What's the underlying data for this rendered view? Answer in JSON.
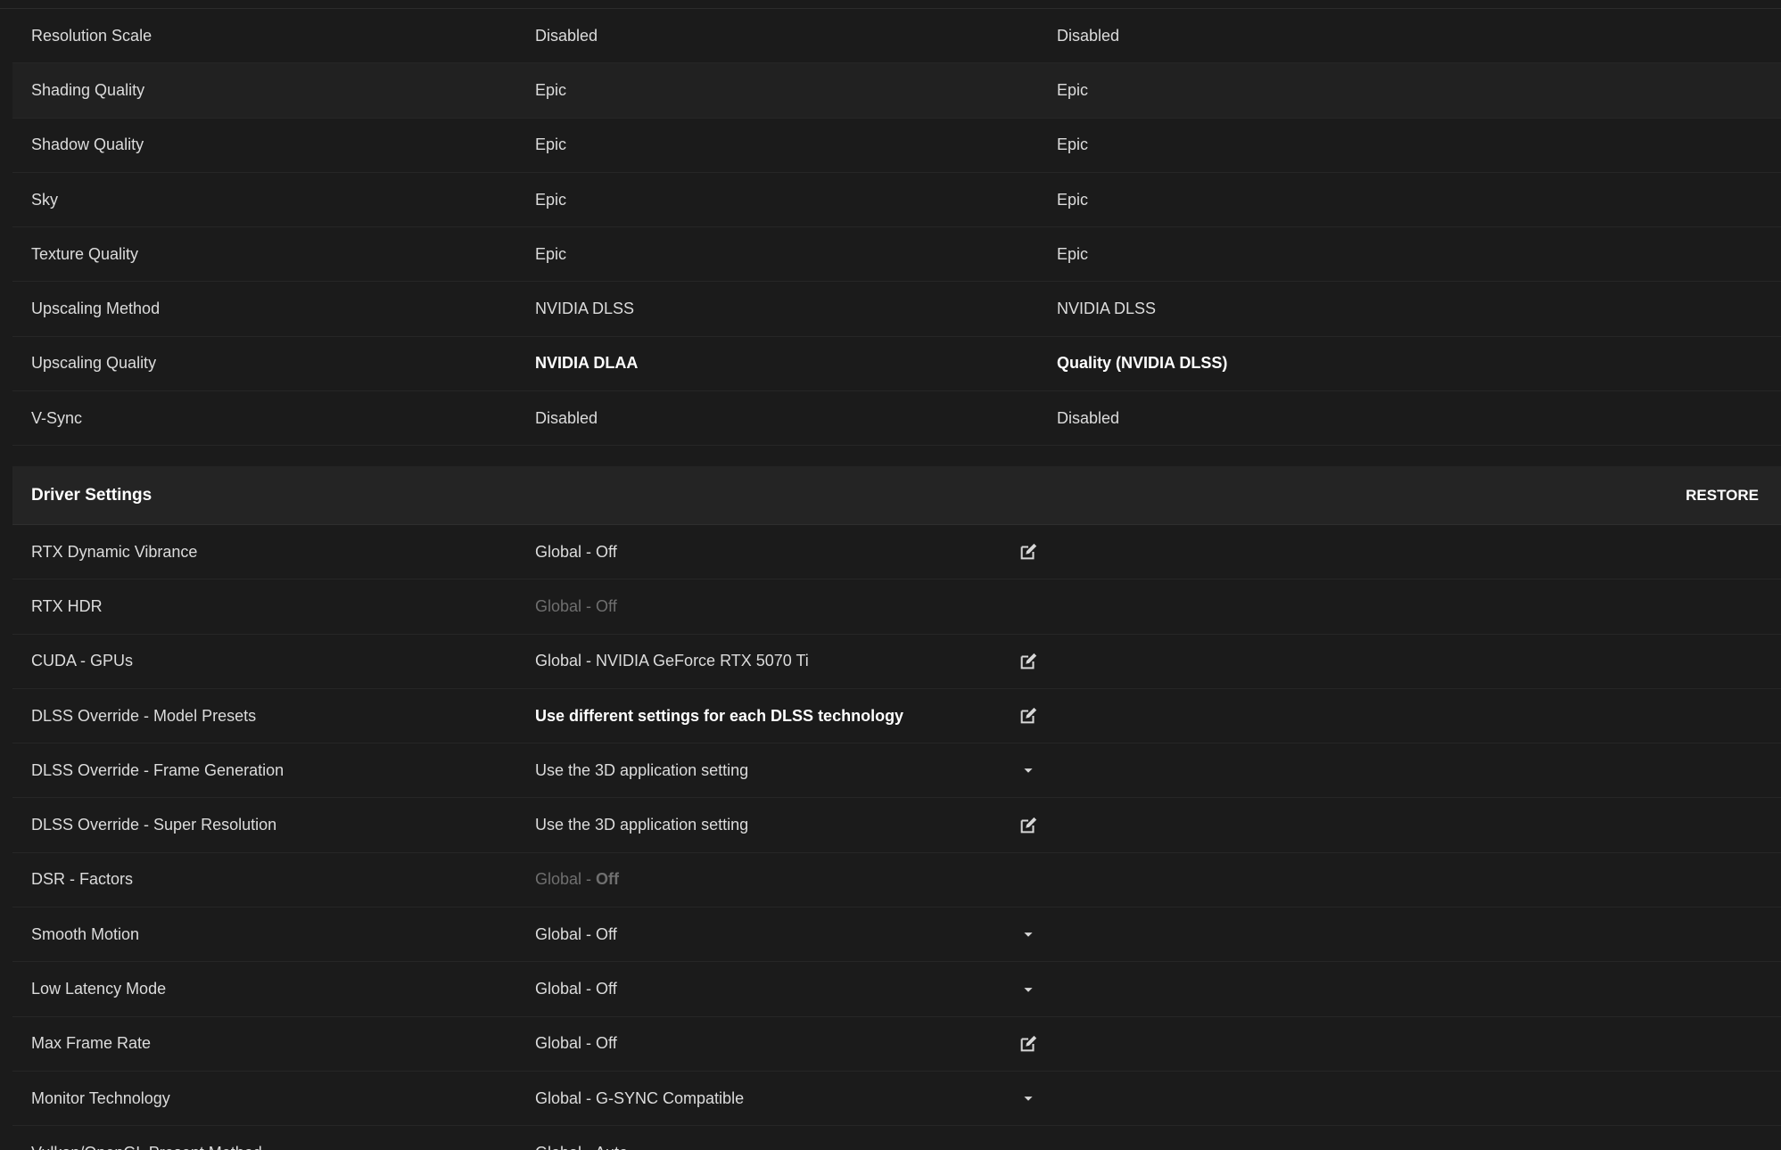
{
  "game_settings": {
    "rows": [
      {
        "name": "Resolution Scale",
        "current": "Disabled",
        "optimal": "Disabled"
      },
      {
        "name": "Shading Quality",
        "current": "Epic",
        "optimal": "Epic"
      },
      {
        "name": "Shadow Quality",
        "current": "Epic",
        "optimal": "Epic"
      },
      {
        "name": "Sky",
        "current": "Epic",
        "optimal": "Epic"
      },
      {
        "name": "Texture Quality",
        "current": "Epic",
        "optimal": "Epic"
      },
      {
        "name": "Upscaling Method",
        "current": "NVIDIA DLSS",
        "optimal": "NVIDIA DLSS"
      },
      {
        "name": "Upscaling Quality",
        "current": "NVIDIA DLAA",
        "optimal": "Quality (NVIDIA DLSS)"
      },
      {
        "name": "V-Sync",
        "current": "Disabled",
        "optimal": "Disabled"
      }
    ]
  },
  "driver_settings": {
    "title": "Driver Settings",
    "restore_label": "RESTORE",
    "rows": [
      {
        "name": "RTX Dynamic Vibrance",
        "value": "Global - Off",
        "control": "edit-icon"
      },
      {
        "name": "RTX HDR",
        "value": "Global - Off",
        "control": ""
      },
      {
        "name": "CUDA - GPUs",
        "value": "Global - NVIDIA GeForce RTX 5070 Ti",
        "control": "edit-icon"
      },
      {
        "name": "DLSS Override - Model Presets",
        "value": "Use different settings for each DLSS technology",
        "control": "edit-icon"
      },
      {
        "name": "DLSS Override - Frame Generation",
        "value": "Use the 3D application setting",
        "control": "chevron-down-icon"
      },
      {
        "name": "DLSS Override - Super Resolution",
        "value": "Use the 3D application setting",
        "control": "edit-icon"
      },
      {
        "name": "DSR - Factors",
        "value_prefix": "Global - ",
        "value_suffix": "Off",
        "control": ""
      },
      {
        "name": "Smooth Motion",
        "value": "Global - Off",
        "control": "chevron-down-icon"
      },
      {
        "name": "Low Latency Mode",
        "value": "Global - Off",
        "control": "chevron-down-icon"
      },
      {
        "name": "Max Frame Rate",
        "value": "Global - Off",
        "control": "edit-icon"
      },
      {
        "name": "Monitor Technology",
        "value": "Global - G-SYNC Compatible",
        "control": "chevron-down-icon"
      },
      {
        "name": "Vulkan/OpenGL Present Method",
        "value": "Global - Auto",
        "control": ""
      }
    ]
  },
  "colors": {
    "background": "#1b1b1b",
    "header_background": "#242424",
    "text": "#dcdcdc",
    "text_bold": "#ffffff",
    "text_disabled": "#6f6f6f"
  }
}
